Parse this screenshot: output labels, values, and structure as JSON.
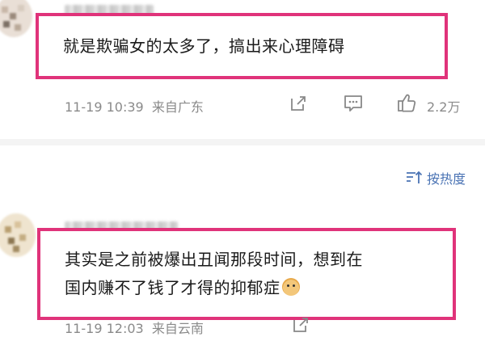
{
  "comments": [
    {
      "text_lines": [
        "就是欺骗女的太多了，搞出来心理障碍"
      ],
      "time": "11-19 10:39",
      "location": "来自广东",
      "likes": "2.2万"
    },
    {
      "text_lines": [
        "其实是之前被爆出丑闻那段时间，想到在",
        "国内赚不了钱了才得的抑郁症"
      ],
      "time": "11-19 12:03",
      "location": "来自云南"
    }
  ],
  "sort": {
    "label": "按热度"
  },
  "colors": {
    "highlight": "#e0337a",
    "link": "#4a73b4",
    "meta": "#8a8a8a"
  },
  "icons": [
    "share-icon",
    "comment-icon",
    "like-icon",
    "sort-icon",
    "dog-emoji-icon"
  ]
}
